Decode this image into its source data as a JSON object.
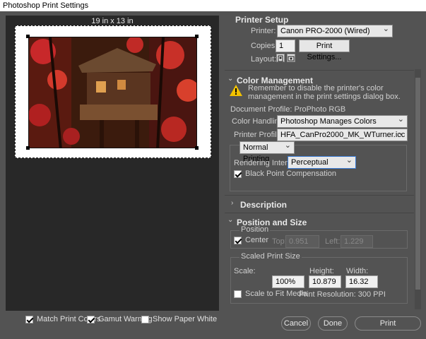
{
  "window": {
    "title": "Photoshop Print Settings"
  },
  "preview": {
    "size_label": "19 in x 13 in"
  },
  "bottom_options": [
    {
      "label": "Match Print Colors",
      "checked": true
    },
    {
      "label": "Gamut Warning",
      "checked": true
    },
    {
      "label": "Show Paper White",
      "checked": false
    }
  ],
  "printer_setup": {
    "title": "Printer Setup",
    "printer_label": "Printer:",
    "printer_value": "Canon PRO-2000 (Wired)",
    "copies_label": "Copies:",
    "copies_value": "1",
    "print_settings_button": "Print Settings...",
    "layout_label": "Layout:",
    "layout_icons": [
      "portrait-orientation-icon",
      "landscape-orientation-icon"
    ]
  },
  "color_management": {
    "title": "Color Management",
    "warning_text_1": "Remember to disable the printer's color",
    "warning_text_2": "management in the print settings dialog box.",
    "document_profile": "Document Profile: ProPhoto RGB",
    "color_handling_label": "Color Handling:",
    "color_handling_value": "Photoshop Manages Colors",
    "printer_profile_label": "Printer Profile:",
    "printer_profile_value": "HFA_CanPro2000_MK_WTurner.icc",
    "printing_mode_value": "Normal Printing",
    "rendering_intent_label": "Rendering Intent:",
    "rendering_intent_value": "Perceptual",
    "bpc_label": "Black Point Compensation",
    "bpc_checked": true
  },
  "description": {
    "title": "Description"
  },
  "position_size": {
    "title": "Position and Size",
    "position_label": "Position",
    "center_label": "Center",
    "center_checked": true,
    "top_label": "Top:",
    "top_value": "0.951",
    "left_label": "Left:",
    "left_value": "1.229",
    "scaled_label": "Scaled Print Size",
    "scale_label": "Scale:",
    "scale_value": "100%",
    "height_label": "Height:",
    "height_value": "10.879",
    "width_label": "Width:",
    "width_value": "16.32",
    "fit_media_label": "Scale to Fit Media",
    "fit_media_checked": false,
    "resolution_text": "Print Resolution: 300 PPI"
  },
  "footer": {
    "cancel": "Cancel",
    "done": "Done",
    "print": "Print"
  }
}
